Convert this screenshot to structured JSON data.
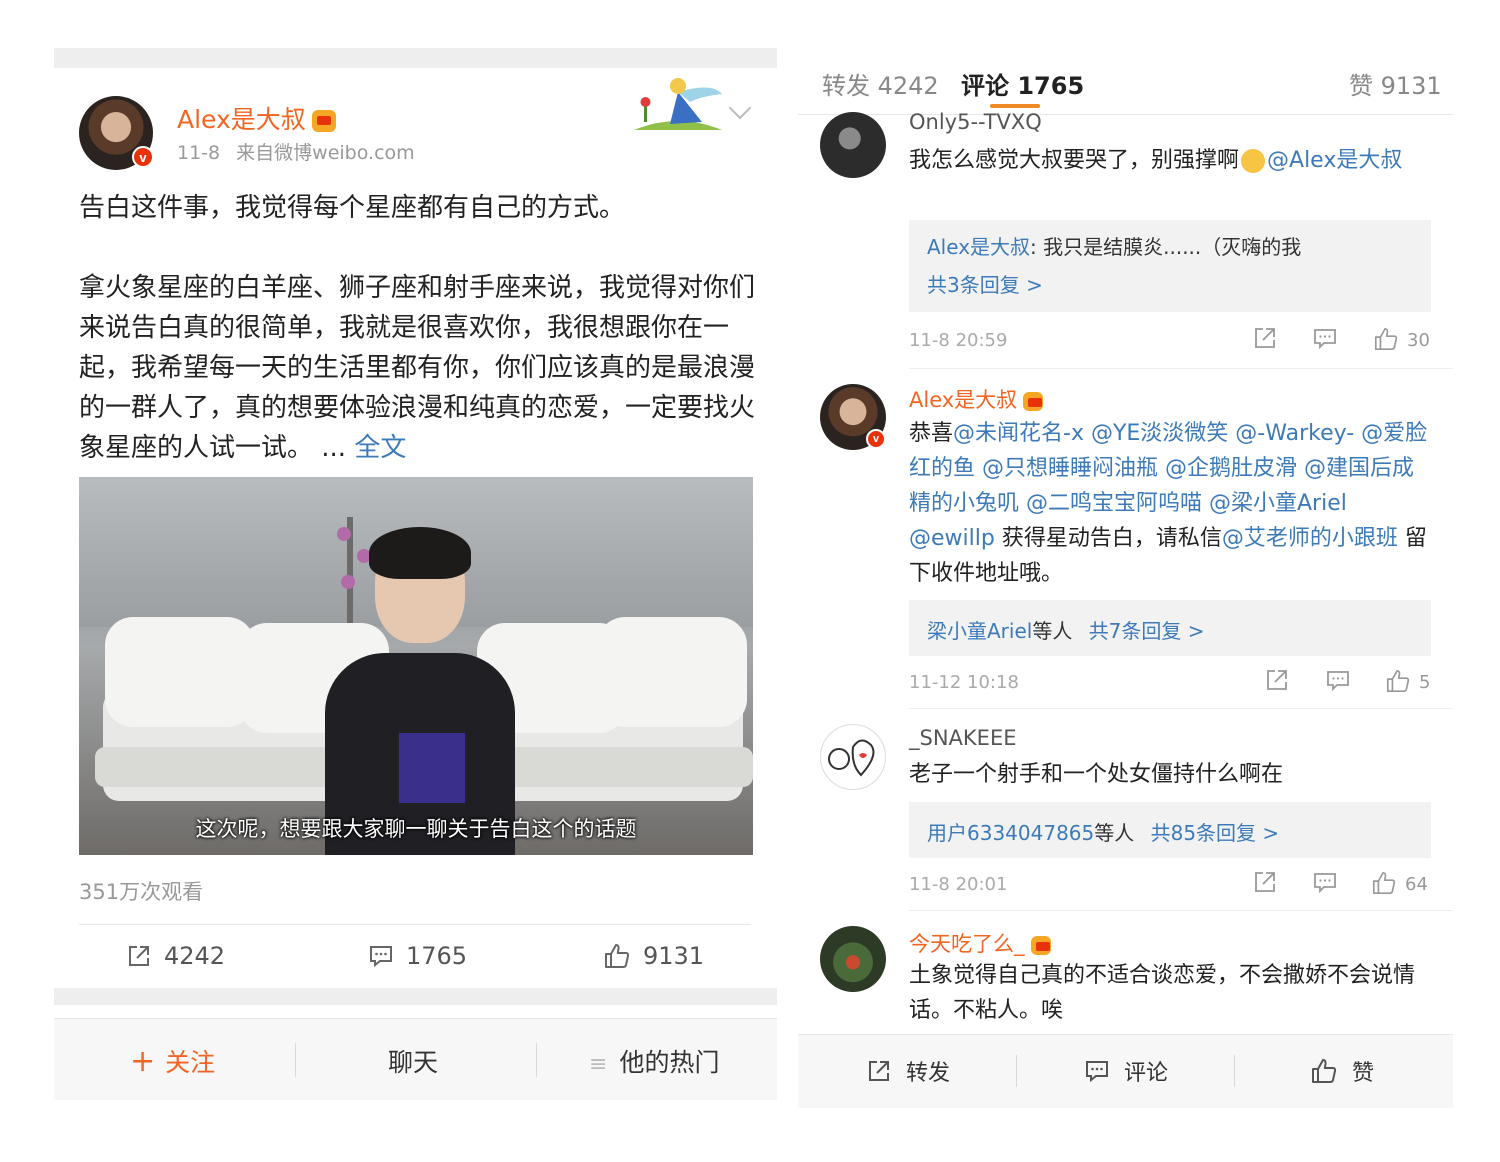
{
  "left": {
    "author": {
      "name": "Alex是大叔",
      "date": "11-8",
      "source": "来自微博weibo.com"
    },
    "post": {
      "para1": "告白这件事，我觉得每个星座都有自己的方式。",
      "para2": "拿火象星座的白羊座、狮子座和射手座来说，我觉得对你们来说告白真的很简单，我就是很喜欢你，我很想跟你在一起，我希望每一天的生活里都有你，你们应该真的是最浪漫的一群人了，真的想要体验浪漫和纯真的恋爱，一定要找火象星座的人试一试。 ...",
      "full_text_link": "全文"
    },
    "video": {
      "subtitle": "这次呢，想要跟大家聊一聊关于告白这个的话题",
      "views": "351万次观看"
    },
    "actions": {
      "repost_count": "4242",
      "comment_count": "1765",
      "like_count": "9131"
    },
    "bottom_bar": {
      "follow_icon": "+",
      "follow": "关注",
      "chat": "聊天",
      "hot_icon": "≡",
      "hot": "他的热门"
    }
  },
  "right": {
    "tabs": {
      "repost": "转发 4242",
      "comments": "评论 1765",
      "likes": "赞 9131"
    },
    "comments": [
      {
        "user": "Only5--TVXQ",
        "text": "我怎么感觉大叔要哭了，别强撑啊",
        "mention": "@Alex是大叔",
        "reply_user": "Alex是大叔",
        "reply_text": ": 我只是结膜炎......（灭嗨的我",
        "reply_more": "共3条回复 >",
        "time": "11-8 20:59",
        "likes": "30"
      },
      {
        "user": "Alex是大叔",
        "text_parts": [
          "恭喜",
          "@未闻花名-x @YE淡淡微笑 @-Warkey- @爱脸红的鱼 @只想睡睡闷油瓶 @企鹅肚皮滑 @建国后成精的小兔叽 @二鸣宝宝阿呜喵 @梁小童Ariel @ewillp",
          " 获得星动告白，请私信",
          "@艾老师的小跟班",
          " 留下收件地址哦。"
        ],
        "reply_user": "梁小童Ariel",
        "reply_suffix": "等人",
        "reply_more": "共7条回复 >",
        "time": "11-12 10:18",
        "likes": "5"
      },
      {
        "user": "_SNAKEEE",
        "text": "老子一个射手和一个处女僵持什么啊在",
        "reply_user": "用户6334047865",
        "reply_suffix": "等人",
        "reply_more": "共85条回复 >",
        "time": "11-8 20:01",
        "likes": "64"
      },
      {
        "user": "今天吃了么_",
        "text": "土象觉得自己真的不适合谈恋爱，不会撒娇不会说情话。不粘人。唉"
      }
    ],
    "bottom_bar": {
      "repost": "转发",
      "comment": "评论",
      "like": "赞"
    }
  },
  "badge_letter": "v",
  "colors": {
    "accent_orange": "#f26522",
    "link_blue": "#3d7ab8",
    "tab_underline": "#f08a24",
    "verified_red": "#e8330a"
  }
}
